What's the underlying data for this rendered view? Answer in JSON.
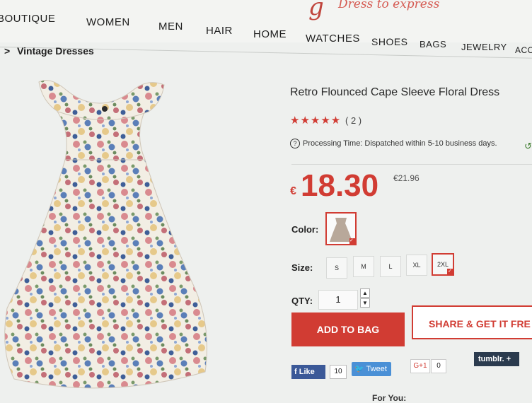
{
  "header": {
    "logo_tagline": "Dress to express",
    "logo_mark": "g",
    "nav": [
      "BOUTIQUE",
      "WOMEN",
      "MEN",
      "HAIR",
      "HOME",
      "WATCHES",
      "SHOES",
      "BAGS",
      "JEWELRY",
      "ACC"
    ]
  },
  "breadcrumb": {
    "arrow": ">",
    "label": "Vintage Dresses"
  },
  "product": {
    "title": "Retro Flounced Cape Sleeve Floral Dress",
    "stars": "★★★★★",
    "rating": 5,
    "reviews": "( 2 )",
    "processing_icon": "?",
    "processing": "Processing Time: Dispatched within 5-10 business days.",
    "currency": "€",
    "price": "18.30",
    "old_price": "€21.96",
    "color_label": "Color:",
    "size_label": "Size:",
    "sizes": [
      "S",
      "M",
      "L",
      "XL",
      "2XL"
    ],
    "selected_size": "2XL",
    "qty_label": "QTY:",
    "qty": "1",
    "add_to_bag": "ADD TO BAG",
    "share": "SHARE & GET IT FRE"
  },
  "social": {
    "fb_label": "Like",
    "fb_count": "10",
    "tweet": "Tweet",
    "gplus": "G+1",
    "gplus_count": "0",
    "tumblr": "tumblr. +"
  },
  "footer_peek": "For You:",
  "colors": {
    "accent": "#d13c33",
    "facebook": "#3b5998",
    "twitter": "#4a90d6",
    "tumblr": "#2b3b4e"
  },
  "icons": [
    "question-circle-icon",
    "star-icon",
    "chevron-up-icon",
    "chevron-down-icon",
    "checkmark-icon"
  ]
}
